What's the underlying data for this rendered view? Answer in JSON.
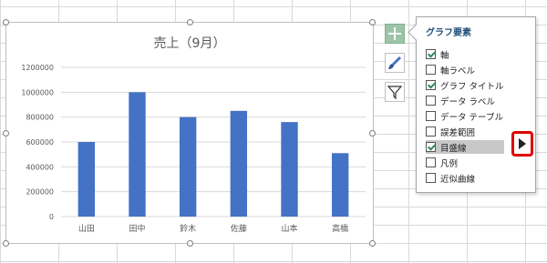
{
  "chart_data": {
    "type": "bar",
    "title": "売上（9月）",
    "categories": [
      "山田",
      "田中",
      "鈴木",
      "佐藤",
      "山本",
      "高橋"
    ],
    "values": [
      600000,
      1000000,
      800000,
      850000,
      760000,
      510000
    ],
    "yticks": [
      0,
      200000,
      400000,
      600000,
      800000,
      1000000,
      1200000
    ],
    "ylim": [
      0,
      1200000
    ],
    "bar_color": "#4472c4",
    "grid": true,
    "legend": false
  },
  "flyout": {
    "title": "グラフ要素",
    "items": [
      {
        "label": "軸",
        "checked": true
      },
      {
        "label": "軸ラベル",
        "checked": false
      },
      {
        "label": "グラフ タイトル",
        "checked": true
      },
      {
        "label": "データ ラベル",
        "checked": false
      },
      {
        "label": "データ テーブル",
        "checked": false
      },
      {
        "label": "誤差範囲",
        "checked": false
      },
      {
        "label": "目盛線",
        "checked": true,
        "highlighted": true
      },
      {
        "label": "凡例",
        "checked": false
      },
      {
        "label": "近似曲線",
        "checked": false
      }
    ]
  },
  "buttons": {
    "chart_elements_icon": "plus-icon",
    "chart_styles_icon": "brush-icon",
    "chart_filters_icon": "filter-icon",
    "more_options_icon": "play-arrow-icon"
  }
}
